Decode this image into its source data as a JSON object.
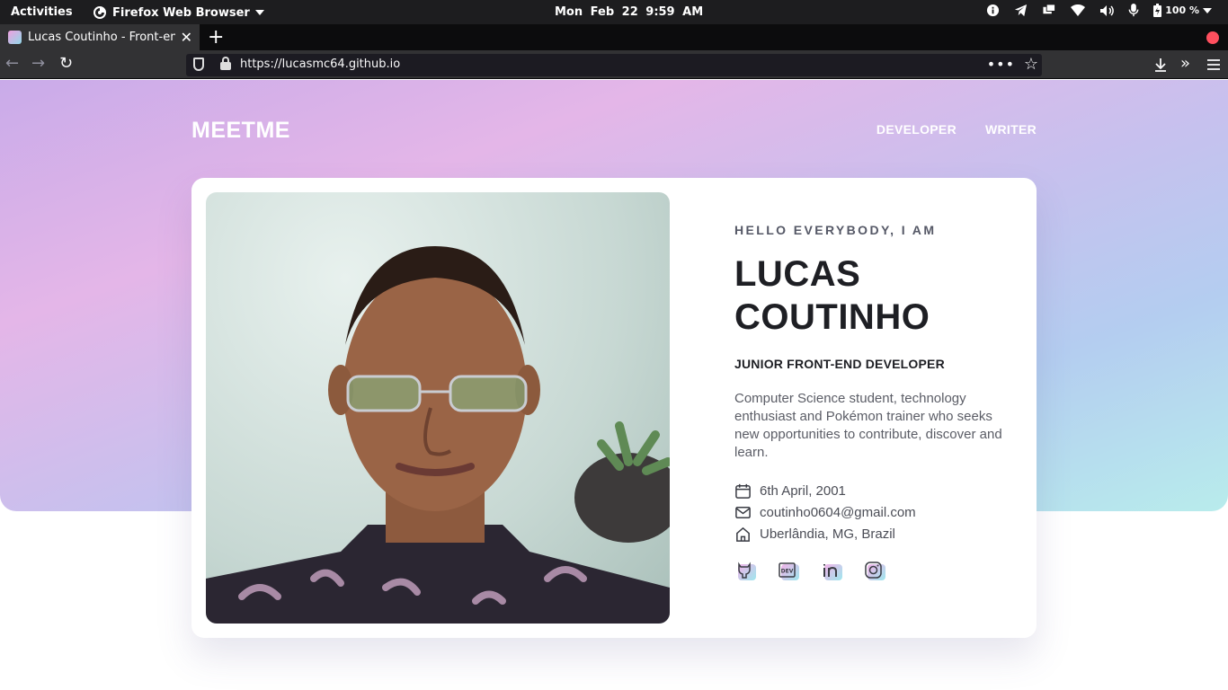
{
  "system_bar": {
    "activities": "Activities",
    "app_name": "Firefox Web Browser",
    "clock": "Mon Feb 22  9:59 AM",
    "battery": "100 %"
  },
  "browser": {
    "tab_title": "Lucas Coutinho - Front-end",
    "url": "https://lucasmc64.github.io"
  },
  "site": {
    "logo": "MEETME",
    "nav": [
      "DEVELOPER",
      "WRITER"
    ],
    "greeting": "HELLO EVERYBODY, I AM",
    "name_line1": "LUCAS",
    "name_line2": "COUTINHO",
    "role": "JUNIOR FRONT-END DEVELOPER",
    "bio": "Computer Science student, technology enthusiast and Pokémon trainer who seeks new opportunities to contribute, discover and learn.",
    "details": {
      "birthday": "6th April, 2001",
      "email": "coutinho0604@gmail.com",
      "location": "Uberlândia, MG, Brazil"
    },
    "social": [
      "github-icon",
      "dev-icon",
      "linkedin-icon",
      "instagram-icon"
    ]
  }
}
